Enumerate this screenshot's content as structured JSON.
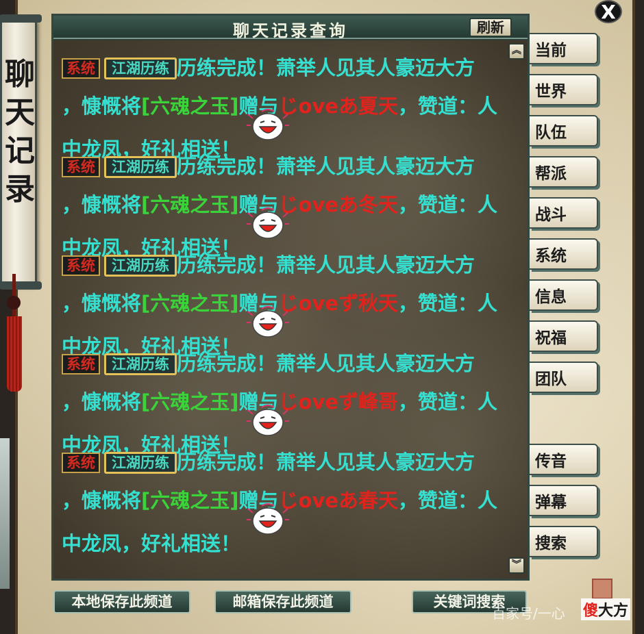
{
  "window": {
    "title": "聊天记录查询",
    "refresh_label": "刷新",
    "close_label": "X",
    "scroll_title": [
      "聊",
      "天",
      "记",
      "录"
    ]
  },
  "messages": [
    {
      "tag_system": "系统",
      "tag_channel": "江湖历练",
      "line1": "历练完成！萧举人见其人豪迈大方",
      "line2_prefix": "，慷慨将",
      "item": "[六魂之玉]",
      "gift": "赠与",
      "player": "じoveあ夏天",
      "line2_suffix": "，赞道：人",
      "line3": "中龙凤，好礼相送！"
    },
    {
      "tag_system": "系统",
      "tag_channel": "江湖历练",
      "line1": "历练完成！萧举人见其人豪迈大方",
      "line2_prefix": "，慷慨将",
      "item": "[六魂之玉]",
      "gift": "赠与",
      "player": "じoveあ冬天",
      "line2_suffix": "，赞道：人",
      "line3": "中龙凤，好礼相送！"
    },
    {
      "tag_system": "系统",
      "tag_channel": "江湖历练",
      "line1": "历练完成！萧举人见其人豪迈大方",
      "line2_prefix": "，慷慨将",
      "item": "[六魂之玉]",
      "gift": "赠与",
      "player": "じoveず秋天",
      "line2_suffix": "，赞道：人",
      "line3": "中龙凤，好礼相送！"
    },
    {
      "tag_system": "系统",
      "tag_channel": "江湖历练",
      "line1": "历练完成！萧举人见其人豪迈大方",
      "line2_prefix": "，慷慨将",
      "item": "[六魂之玉]",
      "gift": "赠与",
      "player": "じoveず峰哥",
      "line2_suffix": "，赞道：人",
      "line3": "中龙凤，好礼相送！"
    },
    {
      "tag_system": "系统",
      "tag_channel": "江湖历练",
      "line1": "历练完成！萧举人见其人豪迈大方",
      "line2_prefix": "，慷慨将",
      "item": "[六魂之玉]",
      "gift": "赠与",
      "player": "じoveあ春天",
      "line2_suffix": "，赞道：人",
      "line3": "中龙凤，好礼相送！"
    }
  ],
  "tabs": {
    "current": "当前",
    "world": "世界",
    "team": "队伍",
    "guild": "帮派",
    "battle": "战斗",
    "system": "系统",
    "info": "信息",
    "blessing": "祝福",
    "group": "团队",
    "whisper": "传音",
    "barrage": "弹幕",
    "search": "搜索"
  },
  "bottom": {
    "save_local": "本地保存此频道",
    "save_mail": "邮箱保存此频道",
    "keyword_search": "关键词搜索"
  },
  "watermark": {
    "text": "百家号/一心",
    "brand_red": "傻",
    "brand_black": "大方"
  },
  "colors": {
    "chat_text": "#35e0d0",
    "item_text": "#3ad43a",
    "player_text": "#e0231c",
    "system_tag": "#d42a20"
  }
}
